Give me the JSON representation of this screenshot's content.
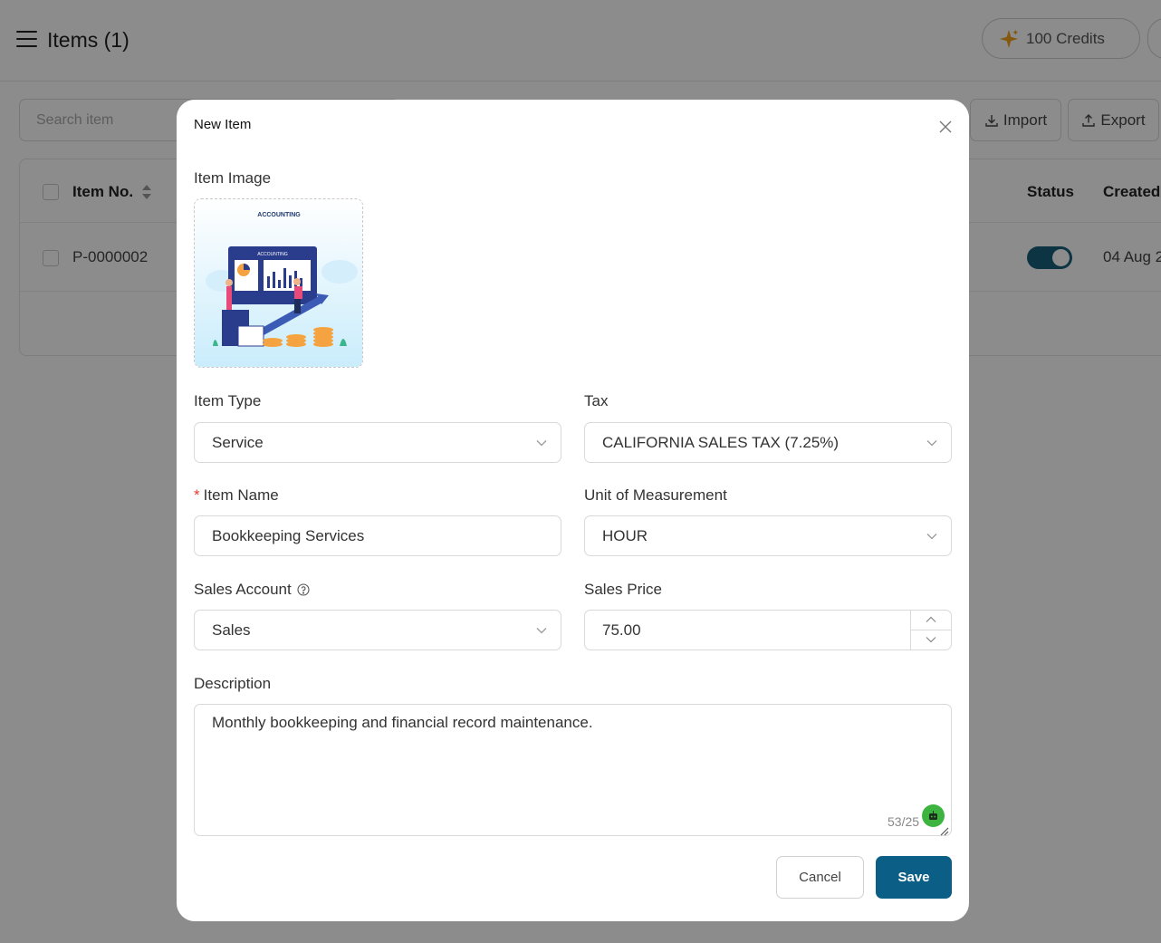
{
  "header": {
    "title": "Items (1)",
    "credits_label": "100 Credits"
  },
  "toolbar": {
    "search_placeholder": "Search item",
    "import_label": "Import",
    "export_label": "Export"
  },
  "table": {
    "columns": [
      "Item No.",
      "Status",
      "Created"
    ],
    "rows": [
      {
        "item_no": "P-0000002",
        "status_on": true,
        "created": "04 Aug 2"
      }
    ]
  },
  "modal": {
    "title": "New Item",
    "image_label": "Item Image",
    "image_caption": "ACCOUNTING",
    "image_screen_caption": "ACCOUNTING",
    "item_type": {
      "label": "Item Type",
      "value": "Service"
    },
    "tax": {
      "label": "Tax",
      "value": "CALIFORNIA SALES TAX (7.25%)"
    },
    "item_name": {
      "label": "Item Name",
      "required_mark": "*",
      "value": "Bookkeeping Services"
    },
    "unit": {
      "label": "Unit of Measurement",
      "value": "HOUR"
    },
    "sales_account": {
      "label": "Sales Account",
      "value": "Sales"
    },
    "sales_price": {
      "label": "Sales Price",
      "value": "75.00"
    },
    "description": {
      "label": "Description",
      "value": "Monthly bookkeeping and financial record maintenance.",
      "counter": "53/25"
    },
    "cancel_label": "Cancel",
    "save_label": "Save"
  },
  "colors": {
    "primary": "#0b5e86",
    "toggle": "#17607a",
    "required": "#e53935",
    "ai_badge": "#3db43f"
  },
  "icons": [
    "hamburger-icon",
    "sparkle-icon",
    "import-icon",
    "export-icon",
    "sort-icon",
    "close-icon",
    "chevron-down-icon",
    "help-icon",
    "chevron-up-icon",
    "robot-icon",
    "resize-icon"
  ]
}
